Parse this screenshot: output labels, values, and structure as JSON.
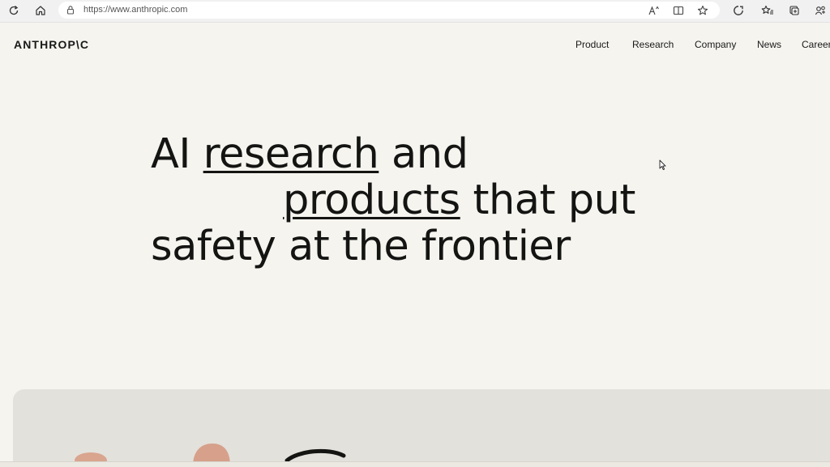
{
  "browser": {
    "url": "https://www.anthropic.com",
    "icons": {
      "reload": "reload-icon",
      "home": "home-icon",
      "lock": "lock-icon",
      "read_aloud": "read-aloud-icon",
      "immersive_reader": "immersive-reader-icon",
      "favorite": "star-icon",
      "extensions": "extensions-icon",
      "favorites": "favorites-icon",
      "collections": "collections-icon",
      "profile": "profile-icon"
    }
  },
  "site": {
    "logo": "ANTHROP\\C",
    "nav": [
      "Product",
      "Research",
      "Company",
      "News",
      "Careers"
    ]
  },
  "hero": {
    "line1_start": "AI ",
    "line1_link": "research",
    "line1_end": " and",
    "line2_link": "products",
    "line2_end": " that put",
    "line3": "safety at the frontier"
  },
  "colors": {
    "background": "#f5f4ef",
    "text": "#141413",
    "card": "#e3e1db",
    "toolbar": "#f1f1f1"
  }
}
